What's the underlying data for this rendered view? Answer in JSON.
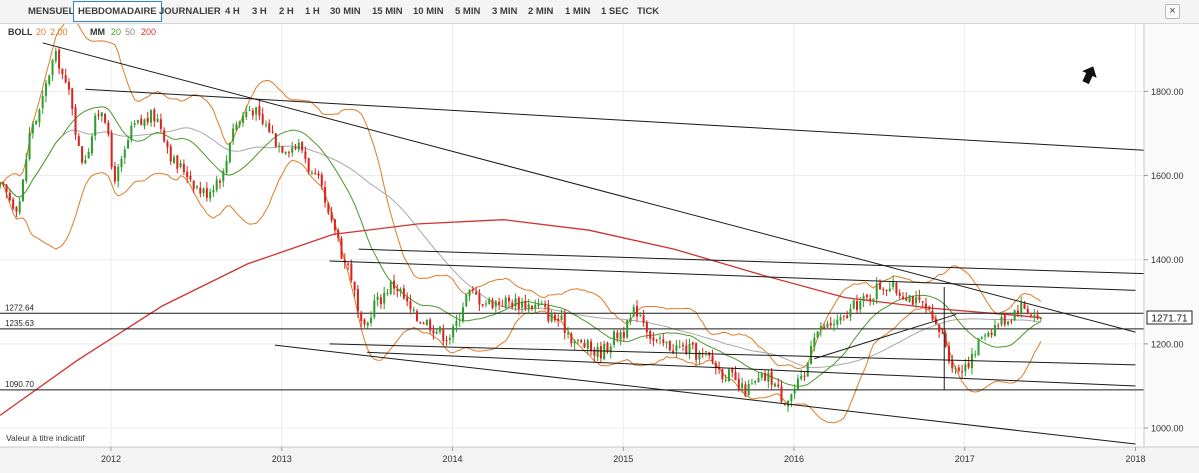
{
  "toolbar": {
    "tabs": [
      "MENSUEL",
      "HEBDOMADAIRE",
      "JOURNALIER",
      "4 H",
      "3 H",
      "2 H",
      "1 H",
      "30 MIN",
      "15 MIN",
      "10 MIN",
      "5 MIN",
      "3 MIN",
      "2 MIN",
      "1 MIN",
      "1 SEC",
      "TICK"
    ],
    "active_tab": "HEBDOMADAIRE",
    "close_label": "×"
  },
  "colors": {
    "up": "#2e9d2e",
    "down": "#d9231d",
    "boll": "#e07b28",
    "mm20": "#4a9a2a",
    "mm50": "#a8a8a8",
    "mm200": "#d32f2f",
    "lines": "#1a1a1a"
  },
  "chart_data": {
    "type": "candlestick",
    "title": "",
    "indicators": {
      "boll": {
        "label": "BOLL",
        "p1": "20",
        "p2": "2.00"
      },
      "mm": {
        "label": "MM",
        "p1": "20",
        "p2": "50",
        "p3": "200"
      }
    },
    "x_ticks": [
      "2012",
      "2013",
      "2014",
      "2015",
      "2016",
      "2017",
      "2018"
    ],
    "x_tick_dates": [
      2012.0,
      2013.0,
      2014.0,
      2015.0,
      2016.0,
      2017.0,
      2018.0
    ],
    "xlim": [
      2011.35,
      2018.05
    ],
    "y_ticks": [
      "1000.00",
      "1200.00",
      "1400.00",
      "1600.00",
      "1800.00"
    ],
    "ylim": [
      955,
      1960
    ],
    "current_price": "1271.71",
    "levels": [
      {
        "value": 1272.64,
        "label": "1272.64"
      },
      {
        "value": 1235.63,
        "label": "1235.63"
      },
      {
        "value": 1090.7,
        "label": "1090.70"
      }
    ],
    "footnote": "Valeur à titre indicatif",
    "anchors": [
      [
        2011.35,
        1570
      ],
      [
        2011.45,
        1530
      ],
      [
        2011.55,
        1730
      ],
      [
        2011.68,
        1880
      ],
      [
        2011.75,
        1800
      ],
      [
        2011.83,
        1640
      ],
      [
        2011.95,
        1760
      ],
      [
        2012.02,
        1600
      ],
      [
        2012.15,
        1720
      ],
      [
        2012.25,
        1740
      ],
      [
        2012.4,
        1620
      ],
      [
        2012.55,
        1560
      ],
      [
        2012.65,
        1600
      ],
      [
        2012.72,
        1720
      ],
      [
        2012.82,
        1760
      ],
      [
        2012.9,
        1720
      ],
      [
        2013.0,
        1670
      ],
      [
        2013.1,
        1670
      ],
      [
        2013.2,
        1590
      ],
      [
        2013.3,
        1480
      ],
      [
        2013.38,
        1390
      ],
      [
        2013.48,
        1230
      ],
      [
        2013.55,
        1300
      ],
      [
        2013.65,
        1340
      ],
      [
        2013.8,
        1260
      ],
      [
        2013.98,
        1220
      ],
      [
        2014.1,
        1320
      ],
      [
        2014.2,
        1300
      ],
      [
        2014.35,
        1300
      ],
      [
        2014.5,
        1290
      ],
      [
        2014.6,
        1260
      ],
      [
        2014.75,
        1200
      ],
      [
        2014.85,
        1180
      ],
      [
        2015.0,
        1230
      ],
      [
        2015.08,
        1280
      ],
      [
        2015.2,
        1200
      ],
      [
        2015.35,
        1190
      ],
      [
        2015.48,
        1170
      ],
      [
        2015.6,
        1130
      ],
      [
        2015.7,
        1090
      ],
      [
        2015.85,
        1120
      ],
      [
        2015.95,
        1070
      ],
      [
        2016.05,
        1110
      ],
      [
        2016.12,
        1230
      ],
      [
        2016.25,
        1250
      ],
      [
        2016.4,
        1300
      ],
      [
        2016.52,
        1340
      ],
      [
        2016.65,
        1320
      ],
      [
        2016.75,
        1290
      ],
      [
        2016.85,
        1230
      ],
      [
        2016.95,
        1140
      ],
      [
        2017.03,
        1160
      ],
      [
        2017.12,
        1230
      ],
      [
        2017.25,
        1260
      ],
      [
        2017.32,
        1290
      ],
      [
        2017.45,
        1260
      ]
    ],
    "trend_lines": [
      {
        "x1": 2011.6,
        "y1": 1915,
        "x2": 2018.0,
        "y2": 1228
      },
      {
        "x1": 2011.85,
        "y1": 1805,
        "x2": 2018.05,
        "y2": 1660
      },
      {
        "x1": 2013.28,
        "y1": 1397,
        "x2": 2018.0,
        "y2": 1327
      },
      {
        "x1": 2013.45,
        "y1": 1425,
        "x2": 2018.05,
        "y2": 1367
      },
      {
        "x1": 2013.28,
        "y1": 1200,
        "x2": 2018.0,
        "y2": 1150
      },
      {
        "x1": 2013.5,
        "y1": 1180,
        "x2": 2018.0,
        "y2": 1100
      },
      {
        "x1": 2012.96,
        "y1": 1197,
        "x2": 2018.0,
        "y2": 962
      },
      {
        "x1": 2016.12,
        "y1": 1165,
        "x2": 2016.95,
        "y2": 1270
      },
      {
        "x1": 2016.88,
        "y1": 1335,
        "x2": 2016.88,
        "y2": 1090
      },
      {
        "x1": 2018.05,
        "y1": 1367,
        "x2": 2018.05,
        "y2": 1700
      },
      {
        "x1": 2018.07,
        "y1": 1338,
        "x2": 2018.07,
        "y2": 1665
      }
    ],
    "marker": {
      "name": "arrow-up-icon",
      "x": 2017.73,
      "y": 1840
    }
  }
}
